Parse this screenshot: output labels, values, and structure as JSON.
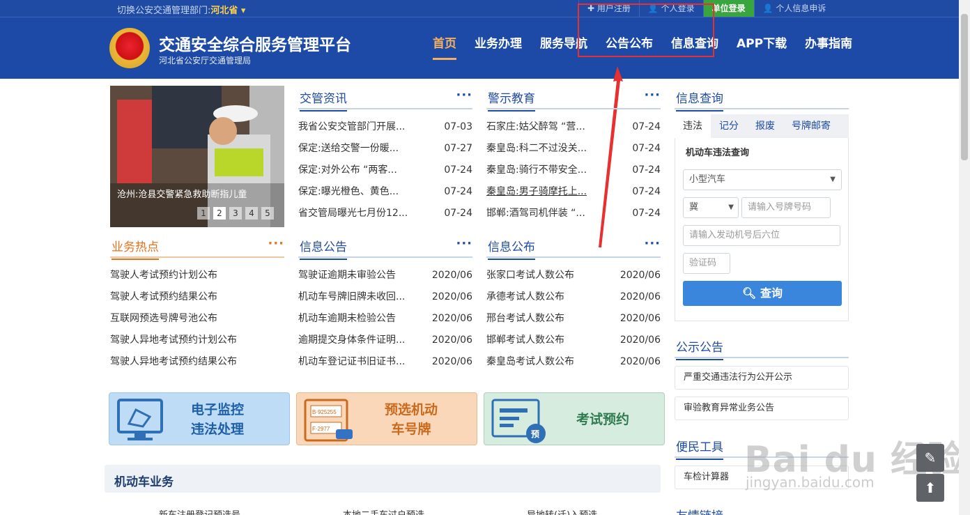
{
  "topbar": {
    "switch_label": "切换公安交通管理部门:",
    "province": "河北省 ▾",
    "links": [
      {
        "label": "✚ 用户注册"
      },
      {
        "label": "👤 个人登录"
      },
      {
        "label": "单位登录"
      },
      {
        "label": "👤 个人信息申诉"
      }
    ]
  },
  "header": {
    "title": "交通安全综合服务管理平台",
    "subtitle": "河北省公安厅交通管理局",
    "nav": [
      {
        "label": "首页"
      },
      {
        "label": "业务办理"
      },
      {
        "label": "服务导航"
      },
      {
        "label": "公告公布"
      },
      {
        "label": "信息查询"
      },
      {
        "label": "APP下载"
      },
      {
        "label": "办事指南"
      }
    ]
  },
  "slider": {
    "caption": "沧州:沧县交警紧急救助断指儿童",
    "pages": [
      "1",
      "2",
      "3",
      "4",
      "5"
    ],
    "current": "2"
  },
  "news": {
    "title": "交管资讯",
    "more": "···",
    "items": [
      {
        "t": "我省公安交管部门开展...",
        "d": "07-03"
      },
      {
        "t": "保定:送给交警一份暖...",
        "d": "07-27"
      },
      {
        "t": "保定:对外公布 “两客...",
        "d": "07-24"
      },
      {
        "t": "保定:曝光橙色、黄色...",
        "d": "07-24"
      },
      {
        "t": "省交管局曝光七月份12...",
        "d": "07-24"
      }
    ]
  },
  "warning": {
    "title": "警示教育",
    "more": "···",
    "items": [
      {
        "t": "石家庄:姑父醉驾 “营...",
        "d": "07-24"
      },
      {
        "t": "秦皇岛:科二不过没关...",
        "d": "07-24"
      },
      {
        "t": "秦皇岛:骑行不带安全...",
        "d": "07-24"
      },
      {
        "t": "秦皇岛:男子骑摩托上...",
        "d": "07-24"
      },
      {
        "t": "邯郸:酒驾司机伴装 “...",
        "d": "07-24"
      }
    ]
  },
  "hot": {
    "title": "业务热点",
    "more": "···",
    "items": [
      {
        "t": "驾驶人考试预约计划公布"
      },
      {
        "t": "驾驶人考试预约结果公布"
      },
      {
        "t": "互联网预选号牌号池公布"
      },
      {
        "t": "驾驶人异地考试预约计划公布"
      },
      {
        "t": "驾驶人异地考试预约结果公布"
      }
    ]
  },
  "notice": {
    "title": "信息公告",
    "more": "···",
    "items": [
      {
        "t": "驾驶证逾期未审验公告",
        "d": "2020/06"
      },
      {
        "t": "机动车号牌旧牌未收回...",
        "d": "2020/06"
      },
      {
        "t": "机动车逾期未检验公告",
        "d": "2020/06"
      },
      {
        "t": "逾期提交身体条件证明...",
        "d": "2020/06"
      },
      {
        "t": "机动车登记证书旧证书...",
        "d": "2020/06"
      }
    ]
  },
  "publish": {
    "title": "信息公布",
    "more": "···",
    "items": [
      {
        "t": "张家口考试人数公布",
        "d": "2020/06"
      },
      {
        "t": "承德考试人数公布",
        "d": "2020/06"
      },
      {
        "t": "邢台考试人数公布",
        "d": "2020/06"
      },
      {
        "t": "邯郸考试人数公布",
        "d": "2020/06"
      },
      {
        "t": "秦皇岛考试人数公布",
        "d": "2020/06"
      }
    ]
  },
  "tiles": {
    "t1a": "电子监控",
    "t1b": "违法处理",
    "t2a": "预选机动",
    "t2b": "车号牌",
    "t3": "考试预约",
    "plate_a": "B·925255",
    "plate_b": "F·2977",
    "badge": "预"
  },
  "section": {
    "title": "机动车业务",
    "stubs": [
      "新车注册登记预选号",
      "本地二手车过户预选",
      "异地转(迁)入预选"
    ]
  },
  "query": {
    "title": "信息查询",
    "tabs": [
      "违法",
      "记分",
      "报废",
      "号牌邮寄"
    ],
    "label": "机动车违法查询",
    "car_type": "小型汽车",
    "prefix": "冀",
    "plate_ph": "请输入号牌号码",
    "engine_ph": "请输入发动机号后六位",
    "captcha_ph": "验证码",
    "button": "查询"
  },
  "public": {
    "title": "公示公告",
    "items": [
      "严重交通违法行为公开公示",
      "审验教育异常业务公告"
    ]
  },
  "tools": {
    "title": "便民工具",
    "items": [
      "车检计算器"
    ]
  },
  "links": {
    "title": "友情链接"
  },
  "watermark": {
    "text": "Bai du 经验",
    "url": "jingyan.baidu.com"
  },
  "colors": {
    "brand": "#1c4aa6",
    "accent": "#f4b060",
    "annotation": "#e83030"
  }
}
